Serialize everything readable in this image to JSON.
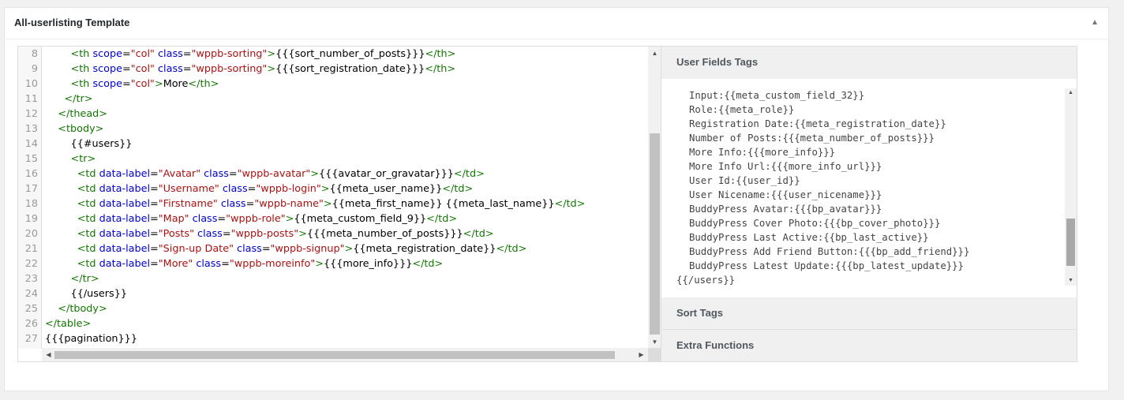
{
  "panel": {
    "title": "All-userlisting Template",
    "toggle_icon": "▲"
  },
  "editor": {
    "lines": [
      {
        "n": "8",
        "indent": "        ",
        "tokens": [
          [
            "tag",
            "<th"
          ],
          [
            "",
            ""
          ],
          [
            "attr",
            " scope"
          ],
          [
            "",
            "="
          ],
          [
            "str",
            "\"col\""
          ],
          [
            "attr",
            " class"
          ],
          [
            "",
            "="
          ],
          [
            "str",
            "\"wppb-sorting\""
          ],
          [
            "tag",
            ">"
          ],
          [
            "",
            "{{{sort_number_of_posts}}}"
          ],
          [
            "tag",
            "</th>"
          ]
        ]
      },
      {
        "n": "9",
        "indent": "        ",
        "tokens": [
          [
            "tag",
            "<th"
          ],
          [
            "attr",
            " scope"
          ],
          [
            "",
            "="
          ],
          [
            "str",
            "\"col\""
          ],
          [
            "attr",
            " class"
          ],
          [
            "",
            "="
          ],
          [
            "str",
            "\"wppb-sorting\""
          ],
          [
            "tag",
            ">"
          ],
          [
            "",
            "{{{sort_registration_date}}}"
          ],
          [
            "tag",
            "</th>"
          ]
        ]
      },
      {
        "n": "10",
        "indent": "        ",
        "tokens": [
          [
            "tag",
            "<th"
          ],
          [
            "attr",
            " scope"
          ],
          [
            "",
            "="
          ],
          [
            "str",
            "\"col\""
          ],
          [
            "tag",
            ">"
          ],
          [
            "",
            "More"
          ],
          [
            "tag",
            "</th>"
          ]
        ]
      },
      {
        "n": "11",
        "indent": "      ",
        "tokens": [
          [
            "tag",
            "</tr>"
          ]
        ]
      },
      {
        "n": "12",
        "indent": "    ",
        "tokens": [
          [
            "tag",
            "</thead>"
          ]
        ]
      },
      {
        "n": "13",
        "indent": "    ",
        "tokens": [
          [
            "tag",
            "<tbody>"
          ]
        ]
      },
      {
        "n": "14",
        "indent": "        ",
        "tokens": [
          [
            "",
            "{{#users}}"
          ]
        ]
      },
      {
        "n": "15",
        "indent": "        ",
        "tokens": [
          [
            "tag",
            "<tr>"
          ]
        ]
      },
      {
        "n": "16",
        "indent": "          ",
        "tokens": [
          [
            "tag",
            "<td"
          ],
          [
            "attr",
            " data-label"
          ],
          [
            "",
            "="
          ],
          [
            "str",
            "\"Avatar\""
          ],
          [
            "attr",
            " class"
          ],
          [
            "",
            "="
          ],
          [
            "str",
            "\"wppb-avatar\""
          ],
          [
            "tag",
            ">"
          ],
          [
            "",
            "{{{avatar_or_gravatar}}}"
          ],
          [
            "tag",
            "</td>"
          ]
        ]
      },
      {
        "n": "17",
        "indent": "          ",
        "tokens": [
          [
            "tag",
            "<td"
          ],
          [
            "attr",
            " data-label"
          ],
          [
            "",
            "="
          ],
          [
            "str",
            "\"Username\""
          ],
          [
            "attr",
            " class"
          ],
          [
            "",
            "="
          ],
          [
            "str",
            "\"wppb-login\""
          ],
          [
            "tag",
            ">"
          ],
          [
            "",
            "{{meta_user_name}}"
          ],
          [
            "tag",
            "</td>"
          ]
        ]
      },
      {
        "n": "18",
        "indent": "          ",
        "tokens": [
          [
            "tag",
            "<td"
          ],
          [
            "attr",
            " data-label"
          ],
          [
            "",
            "="
          ],
          [
            "str",
            "\"Firstname\""
          ],
          [
            "attr",
            " class"
          ],
          [
            "",
            "="
          ],
          [
            "str",
            "\"wppb-name\""
          ],
          [
            "tag",
            ">"
          ],
          [
            "",
            "{{meta_first_name}} {{meta_last_name}}"
          ],
          [
            "tag",
            "</td>"
          ]
        ]
      },
      {
        "n": "19",
        "indent": "          ",
        "tokens": [
          [
            "tag",
            "<td"
          ],
          [
            "attr",
            " data-label"
          ],
          [
            "",
            "="
          ],
          [
            "str",
            "\"Map\""
          ],
          [
            "attr",
            " class"
          ],
          [
            "",
            "="
          ],
          [
            "str",
            "\"wppb-role\""
          ],
          [
            "tag",
            ">"
          ],
          [
            "",
            "{{meta_custom_field_9}}"
          ],
          [
            "tag",
            "</td>"
          ]
        ]
      },
      {
        "n": "20",
        "indent": "          ",
        "tokens": [
          [
            "tag",
            "<td"
          ],
          [
            "attr",
            " data-label"
          ],
          [
            "",
            "="
          ],
          [
            "str",
            "\"Posts\""
          ],
          [
            "attr",
            " class"
          ],
          [
            "",
            "="
          ],
          [
            "str",
            "\"wppb-posts\""
          ],
          [
            "tag",
            ">"
          ],
          [
            "",
            "{{{meta_number_of_posts}}}"
          ],
          [
            "tag",
            "</td>"
          ]
        ]
      },
      {
        "n": "21",
        "indent": "          ",
        "tokens": [
          [
            "tag",
            "<td"
          ],
          [
            "attr",
            " data-label"
          ],
          [
            "",
            "="
          ],
          [
            "str",
            "\"Sign-up Date\""
          ],
          [
            "attr",
            " class"
          ],
          [
            "",
            "="
          ],
          [
            "str",
            "\"wppb-signup\""
          ],
          [
            "tag",
            ">"
          ],
          [
            "",
            "{{meta_registration_date}}"
          ],
          [
            "tag",
            "</td>"
          ]
        ]
      },
      {
        "n": "22",
        "indent": "          ",
        "tokens": [
          [
            "tag",
            "<td"
          ],
          [
            "attr",
            " data-label"
          ],
          [
            "",
            "="
          ],
          [
            "str",
            "\"More\""
          ],
          [
            "attr",
            " class"
          ],
          [
            "",
            "="
          ],
          [
            "str",
            "\"wppb-moreinfo\""
          ],
          [
            "tag",
            ">"
          ],
          [
            "",
            "{{{more_info}}}"
          ],
          [
            "tag",
            "</td>"
          ]
        ]
      },
      {
        "n": "23",
        "indent": "        ",
        "tokens": [
          [
            "tag",
            "</tr>"
          ]
        ]
      },
      {
        "n": "24",
        "indent": "        ",
        "tokens": [
          [
            "",
            "{{/users}}"
          ]
        ]
      },
      {
        "n": "25",
        "indent": "    ",
        "tokens": [
          [
            "tag",
            "</tbody>"
          ]
        ]
      },
      {
        "n": "26",
        "indent": "",
        "tokens": [
          [
            "tag",
            "</table>"
          ]
        ]
      },
      {
        "n": "27",
        "indent": "",
        "tokens": [
          [
            "",
            "{{{pagination}}}"
          ]
        ]
      }
    ]
  },
  "tags": {
    "user_fields_heading": "User Fields Tags",
    "user_fields": [
      "Input:{{meta_custom_field_32}}",
      "Role:{{meta_role}}",
      "Registration Date:{{meta_registration_date}}",
      "Number of Posts:{{{meta_number_of_posts}}}",
      "More Info:{{{more_info}}}",
      "More Info Url:{{{more_info_url}}}",
      "User Id:{{user_id}}",
      "User Nicename:{{{user_nicename}}}",
      "BuddyPress Avatar:{{{bp_avatar}}}",
      "BuddyPress Cover Photo:{{{bp_cover_photo}}}",
      "BuddyPress Last Active:{{bp_last_active}}",
      "BuddyPress Add Friend Button:{{{bp_add_friend}}}",
      "BuddyPress Latest Update:{{{bp_latest_update}}}"
    ],
    "closing": "{{/users}}",
    "sort_heading": "Sort Tags",
    "extra_heading": "Extra Functions"
  }
}
